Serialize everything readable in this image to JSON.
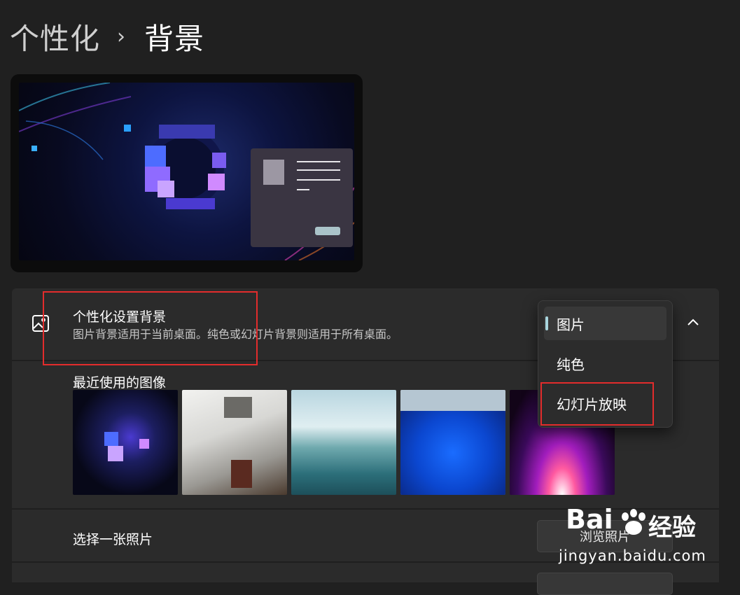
{
  "breadcrumb": {
    "parent": "个性化",
    "separator": "›",
    "current": "背景"
  },
  "preview_window_icon": "app-window-icon",
  "background_setting": {
    "title": "个性化设置背景",
    "description": "图片背景适用于当前桌面。纯色或幻灯片背景则适用于所有桌面。",
    "icon": "image-icon",
    "expand_icon": "chevron-up-icon"
  },
  "dropdown": {
    "selected": "图片",
    "options": [
      "图片",
      "纯色",
      "幻灯片放映"
    ]
  },
  "recent_images": {
    "label": "最近使用的图像",
    "count": 5
  },
  "choose_photo": {
    "label": "选择一张照片",
    "button_label": "浏览照片"
  },
  "watermark": {
    "logo_text_left": "Bai",
    "logo_text_right": "经验",
    "url": "jingyan.baidu.com"
  },
  "colors": {
    "background": "#202020",
    "card": "#2b2b2b",
    "accent": "#a8d5dd",
    "highlight_box": "#e32c2c"
  }
}
